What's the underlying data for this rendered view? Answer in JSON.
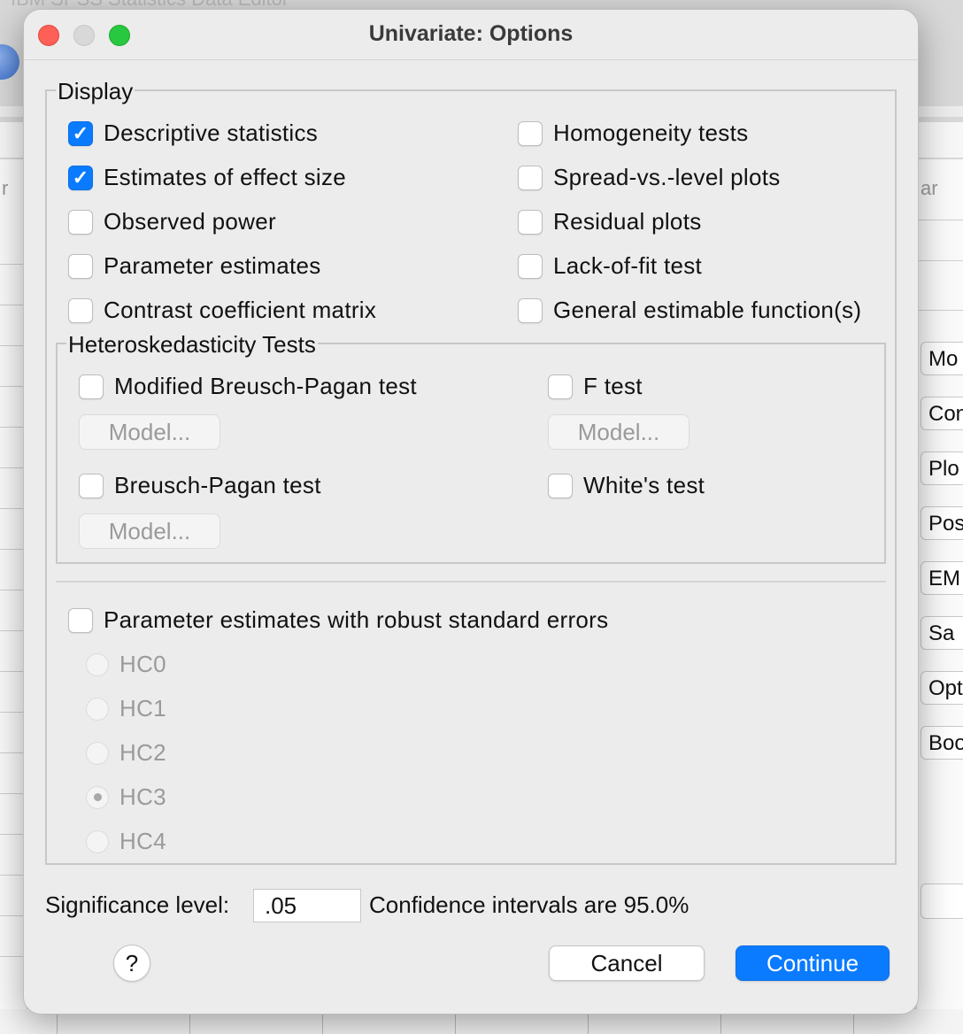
{
  "background": {
    "app_title": "IBM SPSS Statistics Data Editor",
    "col_left": "r",
    "col_right": "ar",
    "side_buttons": [
      "Mo",
      "Cont",
      "Plo",
      "Post",
      "EM M",
      "Sa",
      "Opt",
      "Boot"
    ]
  },
  "dialog": {
    "title": "Univariate: Options"
  },
  "display": {
    "legend": "Display",
    "left": [
      {
        "label": "Descriptive statistics",
        "checked": true
      },
      {
        "label": "Estimates of effect size",
        "checked": true
      },
      {
        "label": "Observed power",
        "checked": false
      },
      {
        "label": "Parameter estimates",
        "checked": false
      },
      {
        "label": "Contrast coefficient matrix",
        "checked": false
      }
    ],
    "right": [
      {
        "label": "Homogeneity tests",
        "checked": false
      },
      {
        "label": "Spread-vs.-level plots",
        "checked": false
      },
      {
        "label": "Residual plots",
        "checked": false
      },
      {
        "label": "Lack-of-fit test",
        "checked": false
      },
      {
        "label": "General estimable function(s)",
        "checked": false
      }
    ]
  },
  "hetero": {
    "legend": "Heteroskedasticity Tests",
    "modified_bp": "Modified Breusch-Pagan test",
    "f_test": "F test",
    "bp": "Breusch-Pagan test",
    "whites": "White's test",
    "model_label": "Model..."
  },
  "robust": {
    "label": "Parameter estimates with robust standard errors",
    "options": [
      "HC0",
      "HC1",
      "HC2",
      "HC3",
      "HC4"
    ],
    "selected": "HC3"
  },
  "footer": {
    "sig_label": "Significance level:",
    "sig_value": ".05",
    "ci_prefix": "Confidence intervals are",
    "ci_value": "95.0%",
    "help": "?",
    "cancel": "Cancel",
    "continue": "Continue"
  }
}
